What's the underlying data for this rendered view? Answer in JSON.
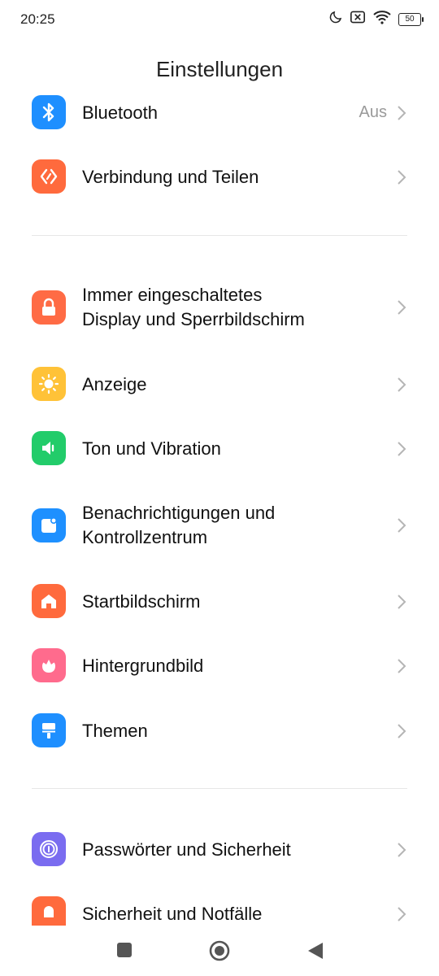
{
  "status": {
    "time": "20:25",
    "battery": "50"
  },
  "header": {
    "title": "Einstellungen"
  },
  "settings": {
    "bluetooth": {
      "label": "Bluetooth",
      "value": "Aus"
    },
    "connection": {
      "label": "Verbindung und Teilen"
    },
    "aod_line1": "Immer eingeschaltetes",
    "aod_line2": "Display und Sperrbildschirm",
    "display": {
      "label": "Anzeige"
    },
    "sound": {
      "label": "Ton und Vibration"
    },
    "notif_line1": "Benachrichtigungen und",
    "notif_line2": "Kontrollzentrum",
    "home": {
      "label": "Startbildschirm"
    },
    "wallpaper": {
      "label": "Hintergrundbild"
    },
    "themes": {
      "label": "Themen"
    },
    "passwords": {
      "label": "Passwörter und Sicherheit"
    },
    "emergency": {
      "label": "Sicherheit und Notfälle"
    }
  },
  "colors": {
    "bluetooth": "#1e8fff",
    "connection": "#ff6a3d",
    "aod": "#ff6b45",
    "display": "#ffc238",
    "sound": "#22cc6a",
    "notif": "#1e90ff",
    "home": "#ff6a3d",
    "wallpaper": "#ff6b8d",
    "themes": "#1e8fff",
    "passwords": "#7a6cf0",
    "emergency": "#ff6a3d"
  },
  "icons": {
    "bluetooth": "bluetooth-icon",
    "connection": "share-icon",
    "aod": "lock-icon",
    "display": "sun-icon",
    "sound": "speaker-icon",
    "notif": "notification-icon",
    "home": "home-icon",
    "wallpaper": "flower-icon",
    "themes": "paint-roller-icon",
    "passwords": "fingerprint-icon",
    "emergency": "emergency-icon"
  }
}
